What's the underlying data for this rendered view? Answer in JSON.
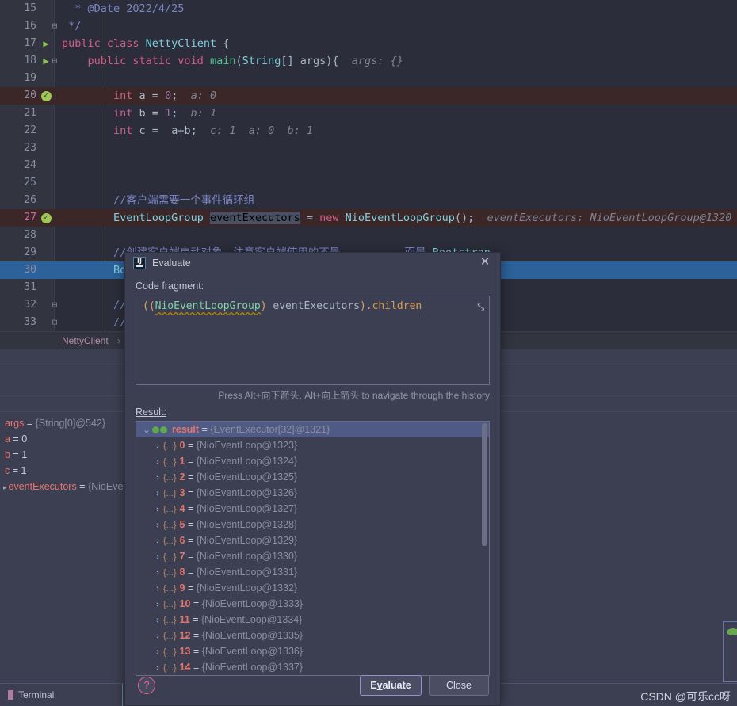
{
  "app": {
    "theme_bg": "#2b2d3a",
    "accent": "#2c6299",
    "watermark": "CSDN @可乐cc呀"
  },
  "editor": {
    "breadcrumb": {
      "class_name": "NettyClient",
      "chevron": "›"
    },
    "lines": [
      {
        "num": "15",
        "mark": "",
        "fold": "",
        "tokens": [
          {
            "t": "  * @Date 2022/4/25",
            "c": "cmt"
          }
        ]
      },
      {
        "num": "16",
        "mark": "",
        "fold": "⊟",
        "tokens": [
          {
            "t": " */",
            "c": "cmt"
          }
        ]
      },
      {
        "num": "17",
        "mark": "run",
        "fold": "",
        "tokens": [
          {
            "t": "public class ",
            "c": "pub"
          },
          {
            "t": "NettyClient",
            "c": "cls"
          },
          {
            "t": " {",
            "c": "pln"
          }
        ]
      },
      {
        "num": "18",
        "mark": "run",
        "fold": "⊟",
        "tokens": [
          {
            "t": "    public static void ",
            "c": "pub"
          },
          {
            "t": "main",
            "c": "mth"
          },
          {
            "t": "(",
            "c": "pln"
          },
          {
            "t": "String",
            "c": "cls"
          },
          {
            "t": "[] ",
            "c": "pln"
          },
          {
            "t": "args",
            "c": "var"
          },
          {
            "t": "){",
            "c": "pln"
          },
          {
            "t": "  args: {}",
            "c": "hint"
          }
        ]
      },
      {
        "num": "19",
        "mark": "",
        "fold": "",
        "tokens": []
      },
      {
        "num": "20",
        "mark": "check",
        "fold": "",
        "hl": "exec",
        "tokens": [
          {
            "t": "        int ",
            "c": "kw"
          },
          {
            "t": "a = ",
            "c": "pln"
          },
          {
            "t": "0",
            "c": "num"
          },
          {
            "t": ";",
            "c": "pln"
          },
          {
            "t": "  a: 0",
            "c": "hint"
          }
        ]
      },
      {
        "num": "21",
        "mark": "",
        "fold": "",
        "tokens": [
          {
            "t": "        int ",
            "c": "kw"
          },
          {
            "t": "b = ",
            "c": "pln"
          },
          {
            "t": "1",
            "c": "num"
          },
          {
            "t": ";",
            "c": "pln"
          },
          {
            "t": "  b: 1",
            "c": "hint"
          }
        ]
      },
      {
        "num": "22",
        "mark": "",
        "fold": "",
        "tokens": [
          {
            "t": "        int ",
            "c": "kw"
          },
          {
            "t": "c = ",
            "c": "pln"
          },
          {
            "t": " a+b;",
            "c": "pln"
          },
          {
            "t": "  c: 1  a: 0  b: 1",
            "c": "hint"
          }
        ]
      },
      {
        "num": "23",
        "mark": "",
        "fold": "",
        "tokens": []
      },
      {
        "num": "24",
        "mark": "",
        "fold": "",
        "tokens": []
      },
      {
        "num": "25",
        "mark": "",
        "fold": "",
        "tokens": []
      },
      {
        "num": "26",
        "mark": "",
        "fold": "",
        "tokens": [
          {
            "t": "        //客户端需要一个事件循环组",
            "c": "cmt"
          }
        ]
      },
      {
        "num": "27",
        "mark": "check",
        "fold": "",
        "hl": "exec",
        "cur": true,
        "tokens": [
          {
            "t": "        ",
            "c": "pln"
          },
          {
            "t": "EventLoopGroup",
            "c": "cls"
          },
          {
            "t": " ",
            "c": "pln"
          },
          {
            "t": "eventExecutors",
            "c": "sel-token"
          },
          {
            "t": " = ",
            "c": "pln"
          },
          {
            "t": "new ",
            "c": "kw"
          },
          {
            "t": "NioEventLoopGroup",
            "c": "cls"
          },
          {
            "t": "();",
            "c": "pln"
          },
          {
            "t": "  eventExecutors: NioEventLoopGroup@1320",
            "c": "hint"
          }
        ]
      },
      {
        "num": "28",
        "mark": "",
        "fold": "",
        "tokens": []
      },
      {
        "num": "29",
        "mark": "",
        "fold": "",
        "tokens": [
          {
            "t": "        //创建客户端启动对象，注意客户端使用的不是",
            "c": "cmt"
          },
          {
            "t": "          而是 ",
            "c": "cmt"
          },
          {
            "t": "Bootstrap",
            "c": "cls"
          }
        ]
      },
      {
        "num": "30",
        "mark": "",
        "fold": "",
        "hl": "sel",
        "tokens": [
          {
            "t": "        ",
            "c": "pln"
          },
          {
            "t": "Bo",
            "c": "cls"
          }
        ]
      },
      {
        "num": "31",
        "mark": "",
        "fold": "",
        "tokens": []
      },
      {
        "num": "32",
        "mark": "",
        "fold": "⊟",
        "tokens": [
          {
            "t": "        //",
            "c": "cmt"
          }
        ]
      },
      {
        "num": "33",
        "mark": "",
        "fold": "⊟",
        "tokens": [
          {
            "t": "        //",
            "c": "cmt"
          }
        ]
      }
    ]
  },
  "variables": {
    "rows": [
      {
        "expand": "",
        "name": "args",
        "value": "{String[0]@542}",
        "kind": "obj"
      },
      {
        "expand": "",
        "name": "a",
        "value": "0",
        "kind": "num"
      },
      {
        "expand": "",
        "name": "b",
        "value": "1",
        "kind": "num"
      },
      {
        "expand": "",
        "name": "c",
        "value": "1",
        "kind": "num"
      },
      {
        "expand": "▸",
        "name": "eventExecutors",
        "value": "{NioEven",
        "kind": "obj"
      }
    ]
  },
  "dialog": {
    "title": "Evaluate",
    "icon_name": "intellij-idea-icon",
    "close_label": "✕",
    "code_fragment_label": "Code fragment:",
    "code_fragment": {
      "open_parens": "((",
      "cast_type": "NioEventLoopGroup",
      "close_paren": ") ",
      "variable": "eventExecutors",
      "close2": ")",
      "dot_prop": ".children",
      "expand_icon": "⤡"
    },
    "history_hint": "Press Alt+向下箭头, Alt+向上箭头 to navigate through the history",
    "result_label": "Result:",
    "result_tree": {
      "root": {
        "twisty": "⌄",
        "icon": "array-icon",
        "name": "result",
        "eq": "=",
        "value": "{EventExecutor[32]@1321}",
        "selected": true
      },
      "children": [
        {
          "twisty": "›",
          "icon": "{...}",
          "name": "0",
          "eq": "=",
          "value": "{NioEventLoop@1323}"
        },
        {
          "twisty": "›",
          "icon": "{...}",
          "name": "1",
          "eq": "=",
          "value": "{NioEventLoop@1324}"
        },
        {
          "twisty": "›",
          "icon": "{...}",
          "name": "2",
          "eq": "=",
          "value": "{NioEventLoop@1325}"
        },
        {
          "twisty": "›",
          "icon": "{...}",
          "name": "3",
          "eq": "=",
          "value": "{NioEventLoop@1326}"
        },
        {
          "twisty": "›",
          "icon": "{...}",
          "name": "4",
          "eq": "=",
          "value": "{NioEventLoop@1327}"
        },
        {
          "twisty": "›",
          "icon": "{...}",
          "name": "5",
          "eq": "=",
          "value": "{NioEventLoop@1328}"
        },
        {
          "twisty": "›",
          "icon": "{...}",
          "name": "6",
          "eq": "=",
          "value": "{NioEventLoop@1329}"
        },
        {
          "twisty": "›",
          "icon": "{...}",
          "name": "7",
          "eq": "=",
          "value": "{NioEventLoop@1330}"
        },
        {
          "twisty": "›",
          "icon": "{...}",
          "name": "8",
          "eq": "=",
          "value": "{NioEventLoop@1331}"
        },
        {
          "twisty": "›",
          "icon": "{...}",
          "name": "9",
          "eq": "=",
          "value": "{NioEventLoop@1332}"
        },
        {
          "twisty": "›",
          "icon": "{...}",
          "name": "10",
          "eq": "=",
          "value": "{NioEventLoop@1333}"
        },
        {
          "twisty": "›",
          "icon": "{...}",
          "name": "11",
          "eq": "=",
          "value": "{NioEventLoop@1334}"
        },
        {
          "twisty": "›",
          "icon": "{...}",
          "name": "12",
          "eq": "=",
          "value": "{NioEventLoop@1335}"
        },
        {
          "twisty": "›",
          "icon": "{...}",
          "name": "13",
          "eq": "=",
          "value": "{NioEventLoop@1336}"
        },
        {
          "twisty": "›",
          "icon": "{...}",
          "name": "14",
          "eq": "=",
          "value": "{NioEventLoop@1337}"
        }
      ]
    },
    "help_label": "?",
    "buttons": {
      "evaluate": {
        "pre": "E",
        "mnemonic": "v",
        "post": "aluate",
        "full": "Evaluate"
      },
      "close": "Close"
    }
  },
  "statusbar": {
    "terminal": "Terminal"
  }
}
